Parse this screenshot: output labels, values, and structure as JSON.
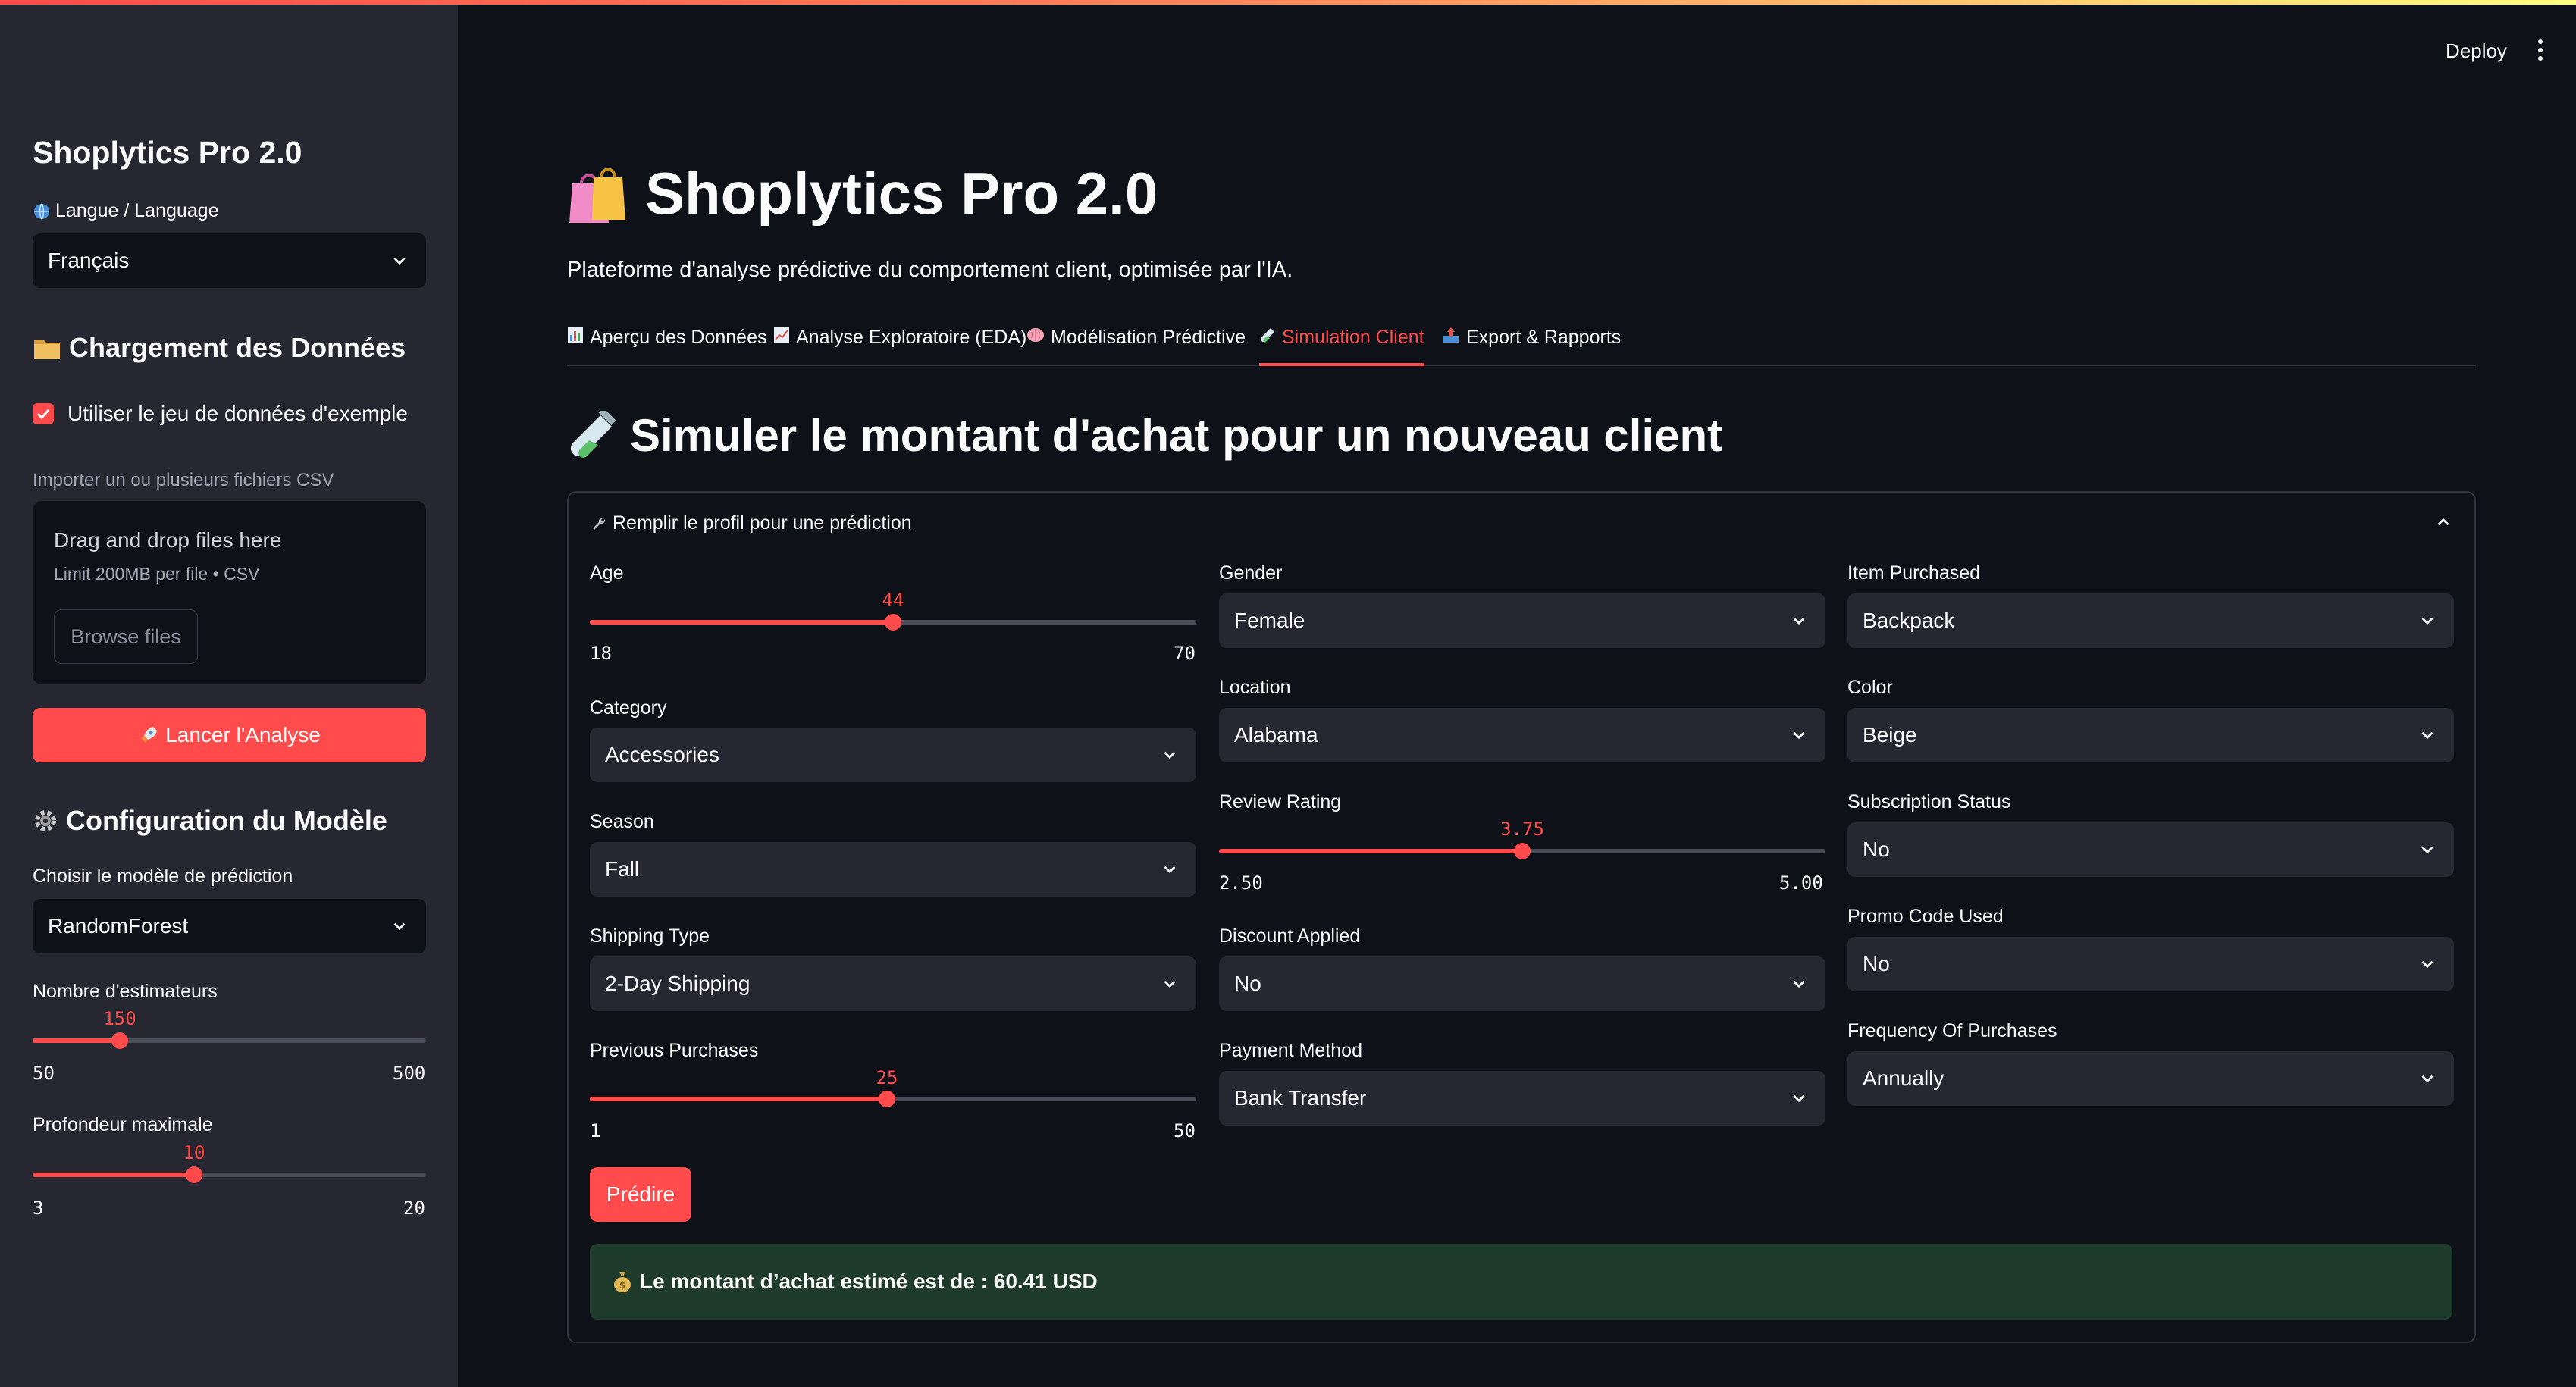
{
  "header": {
    "deploy_label": "Deploy"
  },
  "sidebar": {
    "title": "Shoplytics Pro 2.0",
    "language_label": "Langue / Language",
    "language_value": "Français",
    "data_loading_title": "Chargement des Données",
    "use_sample_label": "Utiliser le jeu de données d'exemple",
    "use_sample_checked": true,
    "upload_label": "Importer un ou plusieurs fichiers CSV",
    "dropzone_title": "Drag and drop files here",
    "dropzone_limit": "Limit 200MB per file • CSV",
    "browse_label": "Browse files",
    "run_button": "Lancer l'Analyse",
    "model_config_title": "Configuration du Modèle",
    "model_label": "Choisir le modèle de prédiction",
    "model_value": "RandomForest",
    "estimators": {
      "label": "Nombre d'estimateurs",
      "value": "150",
      "min": "50",
      "max": "500"
    },
    "max_depth": {
      "label": "Profondeur maximale",
      "value": "10",
      "min": "3",
      "max": "20"
    }
  },
  "main": {
    "title": "Shoplytics Pro 2.0",
    "subtitle": "Plateforme d'analyse prédictive du comportement client, optimisée par l'IA.",
    "tabs": [
      {
        "label": "Aperçu des Données",
        "icon": "bar-chart-icon"
      },
      {
        "label": "Analyse Exploratoire (EDA)",
        "icon": "line-chart-icon"
      },
      {
        "label": "Modélisation Prédictive",
        "icon": "brain-icon"
      },
      {
        "label": "Simulation Client",
        "icon": "test-tube-icon",
        "active": true
      },
      {
        "label": "Export & Rapports",
        "icon": "outbox-icon"
      }
    ],
    "section_title": "Simuler le montant d'achat pour un nouveau client",
    "expander_label": "Remplir le profil pour une prédiction",
    "form": {
      "age": {
        "label": "Age",
        "value": "44",
        "min": "18",
        "max": "70"
      },
      "category": {
        "label": "Category",
        "value": "Accessories"
      },
      "season": {
        "label": "Season",
        "value": "Fall"
      },
      "shipping_type": {
        "label": "Shipping Type",
        "value": "2-Day Shipping"
      },
      "previous_purchases": {
        "label": "Previous Purchases",
        "value": "25",
        "min": "1",
        "max": "50"
      },
      "gender": {
        "label": "Gender",
        "value": "Female"
      },
      "location": {
        "label": "Location",
        "value": "Alabama"
      },
      "review_rating": {
        "label": "Review Rating",
        "value": "3.75",
        "min": "2.50",
        "max": "5.00"
      },
      "discount_applied": {
        "label": "Discount Applied",
        "value": "No"
      },
      "payment_method": {
        "label": "Payment Method",
        "value": "Bank Transfer"
      },
      "item_purchased": {
        "label": "Item Purchased",
        "value": "Backpack"
      },
      "color": {
        "label": "Color",
        "value": "Beige"
      },
      "subscription_status": {
        "label": "Subscription Status",
        "value": "No"
      },
      "promo_code_used": {
        "label": "Promo Code Used",
        "value": "No"
      },
      "frequency": {
        "label": "Frequency Of Purchases",
        "value": "Annually"
      }
    },
    "predict_button": "Prédire",
    "result_text": "Le montant d’achat estimé est de : 60.41 USD"
  },
  "colors": {
    "accent": "#ff4b4b",
    "background": "#0e1117",
    "sidebar": "#262730",
    "success_bg": "#1f3b2c"
  }
}
